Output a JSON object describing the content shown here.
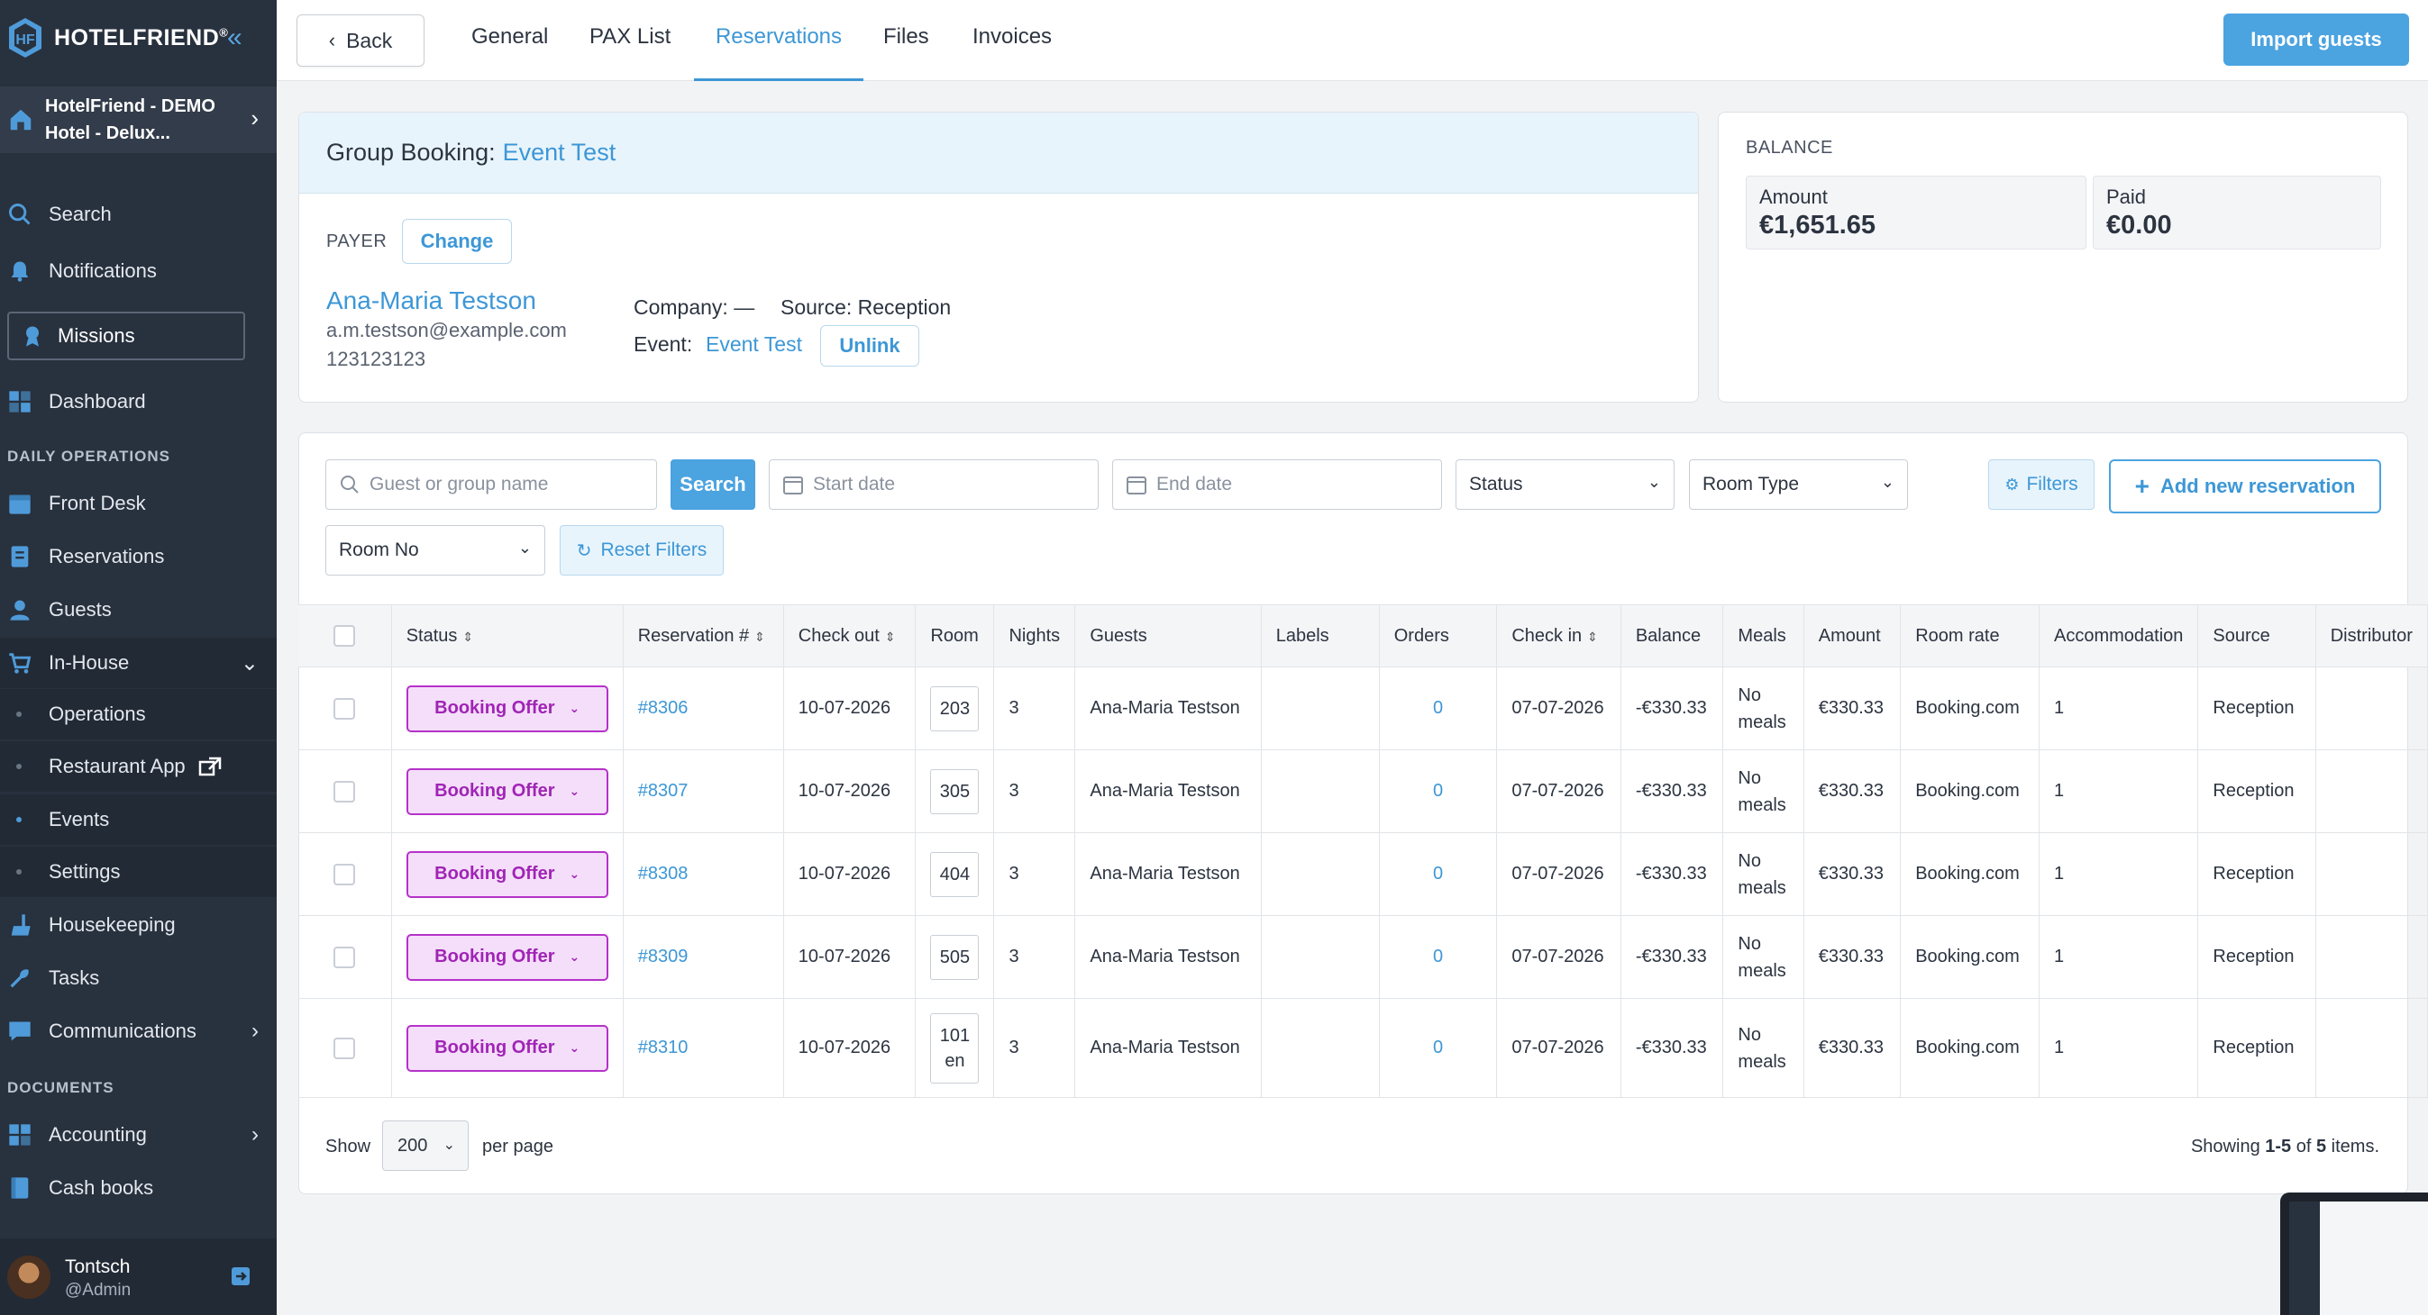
{
  "sidebar": {
    "brand": "HOTELFRIEND",
    "brand_mark": "®",
    "hotel_name": "HotelFriend - DEMO Hotel - Delux...",
    "search": "Search",
    "notifications": "Notifications",
    "missions": "Missions",
    "dashboard": "Dashboard",
    "section_daily": "DAILY OPERATIONS",
    "front_desk": "Front Desk",
    "reservations": "Reservations",
    "guests": "Guests",
    "in_house": "In-House",
    "operations": "Operations",
    "restaurant_app": "Restaurant App",
    "events": "Events",
    "settings": "Settings",
    "housekeeping": "Housekeeping",
    "tasks": "Tasks",
    "communications": "Communications",
    "section_documents": "DOCUMENTS",
    "accounting": "Accounting",
    "cash_books": "Cash books",
    "user_name": "Tontsch",
    "user_handle": "@Admin"
  },
  "topbar": {
    "back": "Back",
    "tabs": [
      "General",
      "PAX List",
      "Reservations",
      "Files",
      "Invoices"
    ],
    "active_tab": "Reservations",
    "import": "Import guests"
  },
  "group": {
    "label": "Group Booking:",
    "name": "Event Test",
    "payer_label": "PAYER",
    "change": "Change",
    "payer_name": "Ana-Maria Testson",
    "payer_email": "a.m.testson@example.com",
    "payer_phone": "123123123",
    "company_label": "Company:",
    "company_value": "—",
    "source_label": "Source:",
    "source_value": "Reception",
    "event_label": "Event:",
    "event_value": "Event Test",
    "unlink": "Unlink"
  },
  "balance": {
    "title": "BALANCE",
    "amount_label": "Amount",
    "amount_value": "€1,651.65",
    "paid_label": "Paid",
    "paid_value": "€0.00"
  },
  "filters": {
    "guest_placeholder": "Guest or group name",
    "search": "Search",
    "start_date": "Start date",
    "end_date": "End date",
    "status": "Status",
    "room_type": "Room Type",
    "filters": "Filters",
    "add": "Add new reservation",
    "room_no": "Room No",
    "reset": "Reset Filters"
  },
  "table": {
    "headers": [
      "Status",
      "Reservation #",
      "Check out",
      "Room",
      "Nights",
      "Guests",
      "Labels",
      "Orders",
      "Check in",
      "Balance",
      "Meals",
      "Amount",
      "Room rate",
      "Accommodation",
      "Source",
      "Distributor"
    ],
    "rows": [
      {
        "status": "Booking Offer",
        "res": "#8306",
        "checkout": "10-07-2026",
        "room": "203",
        "nights": "3",
        "guest": "Ana-Maria Testson",
        "labels": "",
        "orders": "0",
        "checkin": "07-07-2026",
        "balance": "-€330.33",
        "meals": "No meals",
        "amount": "€330.33",
        "rate": "Booking.com",
        "accom": "1",
        "source": "Reception",
        "distributor": ""
      },
      {
        "status": "Booking Offer",
        "res": "#8307",
        "checkout": "10-07-2026",
        "room": "305",
        "nights": "3",
        "guest": "Ana-Maria Testson",
        "labels": "",
        "orders": "0",
        "checkin": "07-07-2026",
        "balance": "-€330.33",
        "meals": "No meals",
        "amount": "€330.33",
        "rate": "Booking.com",
        "accom": "1",
        "source": "Reception",
        "distributor": ""
      },
      {
        "status": "Booking Offer",
        "res": "#8308",
        "checkout": "10-07-2026",
        "room": "404",
        "nights": "3",
        "guest": "Ana-Maria Testson",
        "labels": "",
        "orders": "0",
        "checkin": "07-07-2026",
        "balance": "-€330.33",
        "meals": "No meals",
        "amount": "€330.33",
        "rate": "Booking.com",
        "accom": "1",
        "source": "Reception",
        "distributor": ""
      },
      {
        "status": "Booking Offer",
        "res": "#8309",
        "checkout": "10-07-2026",
        "room": "505",
        "nights": "3",
        "guest": "Ana-Maria Testson",
        "labels": "",
        "orders": "0",
        "checkin": "07-07-2026",
        "balance": "-€330.33",
        "meals": "No meals",
        "amount": "€330.33",
        "rate": "Booking.com",
        "accom": "1",
        "source": "Reception",
        "distributor": ""
      },
      {
        "status": "Booking Offer",
        "res": "#8310",
        "checkout": "10-07-2026",
        "room": "101 en",
        "nights": "3",
        "guest": "Ana-Maria Testson",
        "labels": "",
        "orders": "0",
        "checkin": "07-07-2026",
        "balance": "-€330.33",
        "meals": "No meals",
        "amount": "€330.33",
        "rate": "Booking.com",
        "accom": "1",
        "source": "Reception",
        "distributor": ""
      }
    ]
  },
  "pagination": {
    "show": "Show",
    "per_page_value": "200",
    "per_page": "per page",
    "showing_prefix": "Showing",
    "showing_range": "1-5",
    "showing_of": "of",
    "showing_total": "5",
    "showing_suffix": "items."
  },
  "colors": {
    "accent": "#4ba3e0",
    "sidebar": "#28313e",
    "status_bg": "#f4defa",
    "status_border": "#b532c9"
  }
}
